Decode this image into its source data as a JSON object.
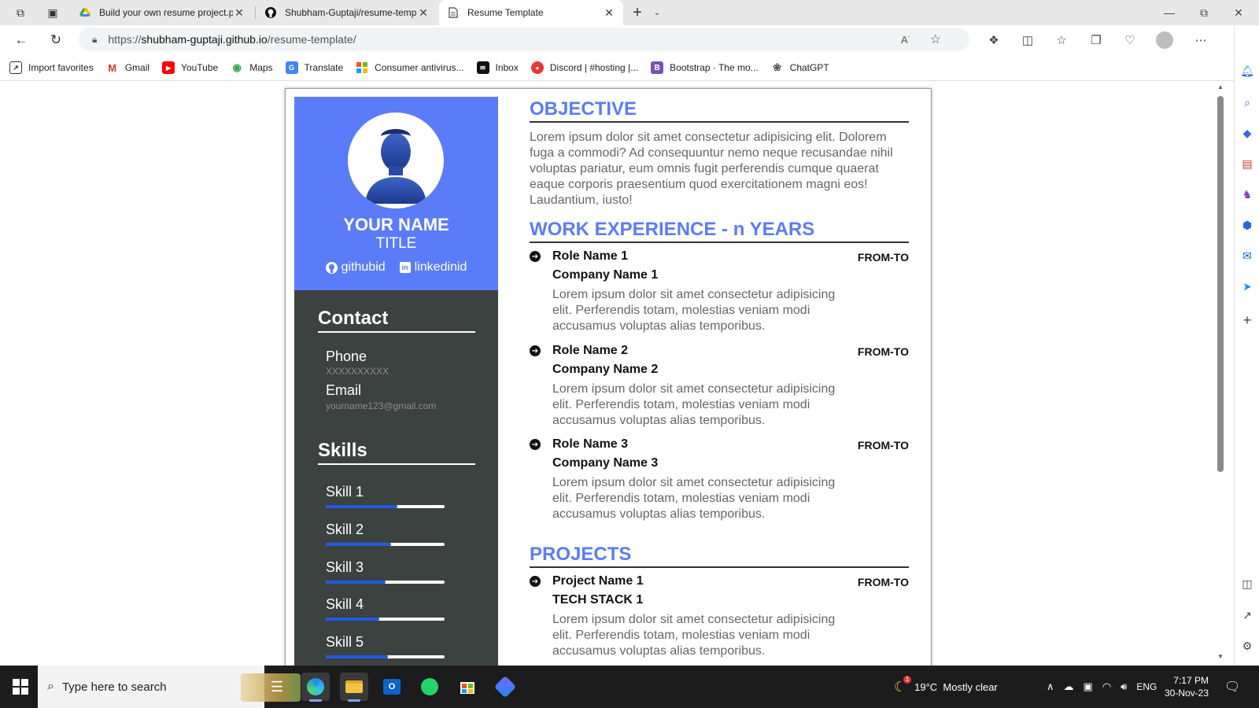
{
  "browser": {
    "tabs": [
      {
        "title": "Build your own resume project.p",
        "icon": "google-drive-icon"
      },
      {
        "title": "Shubham-Guptaji/resume-templ",
        "icon": "github-icon"
      },
      {
        "title": "Resume Template",
        "icon": "page-icon",
        "active": true
      }
    ],
    "url_scheme": "https://",
    "url_host": "shubham-guptaji.github.io",
    "url_path": "/resume-template/",
    "favorites": [
      {
        "label": "Import favorites",
        "icon": "import-icon"
      },
      {
        "label": "Gmail",
        "icon": "gmail-icon",
        "color": "#d93025"
      },
      {
        "label": "YouTube",
        "icon": "youtube-icon",
        "color": "#ff0000"
      },
      {
        "label": "Maps",
        "icon": "maps-icon",
        "color": "#34a853"
      },
      {
        "label": "Translate",
        "icon": "translate-icon",
        "color": "#4285f4"
      },
      {
        "label": "Consumer antivirus...",
        "icon": "microsoft-icon"
      },
      {
        "label": "Inbox",
        "icon": "inbox-icon"
      },
      {
        "label": "Discord | #hosting |...",
        "icon": "discord-icon"
      },
      {
        "label": "Bootstrap · The mo...",
        "icon": "bootstrap-icon",
        "color": "#7952b3"
      },
      {
        "label": "ChatGPT",
        "icon": "chatgpt-icon"
      }
    ]
  },
  "resume": {
    "name": "YOUR NAME",
    "title": "TITLE",
    "github": "githubid",
    "linkedin": "linkedinid",
    "contact_heading": "Contact",
    "phone_label": "Phone",
    "phone_value": "XXXXXXXXXX",
    "email_label": "Email",
    "email_value": "yourname123@gmail.com",
    "skills_heading": "Skills",
    "skills": [
      {
        "name": "Skill 1",
        "level": 0.6
      },
      {
        "name": "Skill 2",
        "level": 0.55
      },
      {
        "name": "Skill 3",
        "level": 0.5
      },
      {
        "name": "Skill 4",
        "level": 0.45
      },
      {
        "name": "Skill 5",
        "level": 0.52
      }
    ],
    "objective_heading": "OBJECTIVE",
    "objective_text": "Lorem ipsum dolor sit amet consectetur adipisicing elit. Dolorem fuga a commodi? Ad consequuntur nemo neque recusandae nihil voluptas pariatur, eum omnis fugit perferendis cumque quaerat eaque corporis praesentium quod exercitationem magni eos! Laudantium, iusto!",
    "work_heading": "WORK EXPERIENCE - n YEARS",
    "work": [
      {
        "role": "Role Name 1",
        "company": "Company Name 1",
        "dates": "FROM-TO",
        "desc": "Lorem ipsum dolor sit amet consectetur adipisicing elit. Perferendis totam, molestias veniam modi accusamus voluptas alias temporibus."
      },
      {
        "role": "Role Name 2",
        "company": "Company Name 2",
        "dates": "FROM-TO",
        "desc": "Lorem ipsum dolor sit amet consectetur adipisicing elit. Perferendis totam, molestias veniam modi accusamus voluptas alias temporibus."
      },
      {
        "role": "Role Name 3",
        "company": "Company Name 3",
        "dates": "FROM-TO",
        "desc": "Lorem ipsum dolor sit amet consectetur adipisicing elit. Perferendis totam, molestias veniam modi accusamus voluptas alias temporibus."
      }
    ],
    "projects_heading": "PROJECTS",
    "projects": [
      {
        "name": "Project Name 1",
        "stack": "TECH STACK 1",
        "dates": "FROM-TO",
        "desc": "Lorem ipsum dolor sit amet consectetur adipisicing elit. Perferendis totam, molestias veniam modi accusamus voluptas alias temporibus."
      }
    ]
  },
  "taskbar": {
    "search_placeholder": "Type here to search",
    "weather": "19°C  Mostly clear",
    "language": "ENG",
    "time": "7:17 PM",
    "date": "30-Nov-23",
    "notification_badge": "1"
  },
  "colors": {
    "accent": "#5b7cf9",
    "sidebar_dark": "#3c4240",
    "skill_fill": "#1e5ce0"
  }
}
